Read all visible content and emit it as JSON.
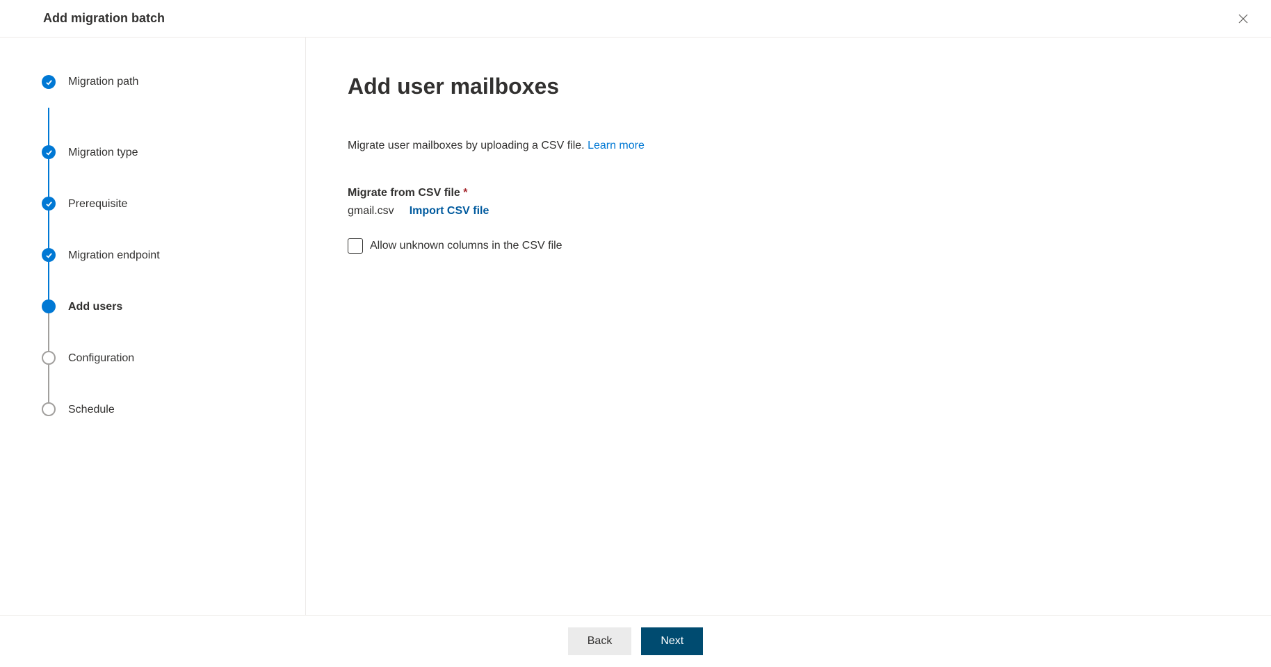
{
  "header": {
    "title": "Add migration batch"
  },
  "steps": [
    {
      "label": "Migration path",
      "state": "completed"
    },
    {
      "label": "Migration type",
      "state": "completed"
    },
    {
      "label": "Prerequisite",
      "state": "completed"
    },
    {
      "label": "Migration endpoint",
      "state": "completed"
    },
    {
      "label": "Add users",
      "state": "current"
    },
    {
      "label": "Configuration",
      "state": "pending"
    },
    {
      "label": "Schedule",
      "state": "pending"
    }
  ],
  "main": {
    "heading": "Add user mailboxes",
    "description": "Migrate user mailboxes by uploading a CSV file. ",
    "learn_more": "Learn more",
    "field_label": "Migrate from CSV file",
    "file_name": "gmail.csv",
    "import_label": "Import CSV file",
    "checkbox_label": "Allow unknown columns in the CSV file"
  },
  "footer": {
    "back": "Back",
    "next": "Next"
  }
}
